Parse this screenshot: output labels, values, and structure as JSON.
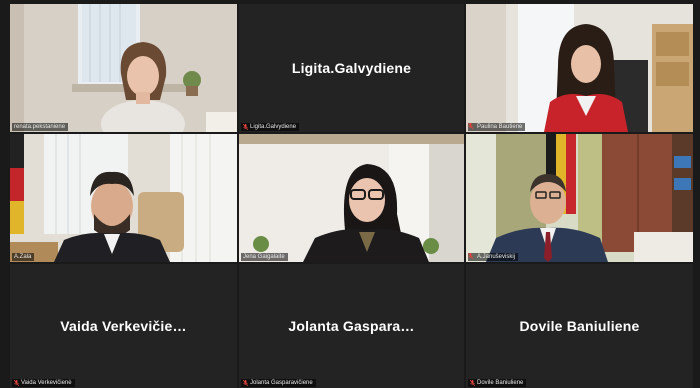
{
  "participants": [
    {
      "tag": "renata.pekstaniene",
      "big_name": "",
      "has_video": true,
      "muted": false
    },
    {
      "tag": "Ligita.Galvydiene",
      "big_name": "Ligita.Galvydiene",
      "has_video": false,
      "muted": true
    },
    {
      "tag": "Paulina Bautiene",
      "big_name": "",
      "has_video": true,
      "muted": true
    },
    {
      "tag": "A.Zala",
      "big_name": "",
      "has_video": true,
      "muted": false
    },
    {
      "tag": "Jena Gaigalaite",
      "big_name": "",
      "has_video": true,
      "muted": false
    },
    {
      "tag": "A.Januševiskij",
      "big_name": "",
      "has_video": true,
      "muted": true
    },
    {
      "tag": "Vaida Verkevičienė",
      "big_name": "Vaida  Verkevičie…",
      "has_video": false,
      "muted": true
    },
    {
      "tag": "Jolanta Gasparavičiene",
      "big_name": "Jolanta  Gaspara…",
      "has_video": false,
      "muted": true
    },
    {
      "tag": "Dovile Baniuliene",
      "big_name": "Dovile Baniuliene",
      "has_video": false,
      "muted": true
    }
  ],
  "colors": {
    "active_border": "#c9dd2c",
    "muted_icon": "#e0453a",
    "tile_bg": "#232323"
  }
}
